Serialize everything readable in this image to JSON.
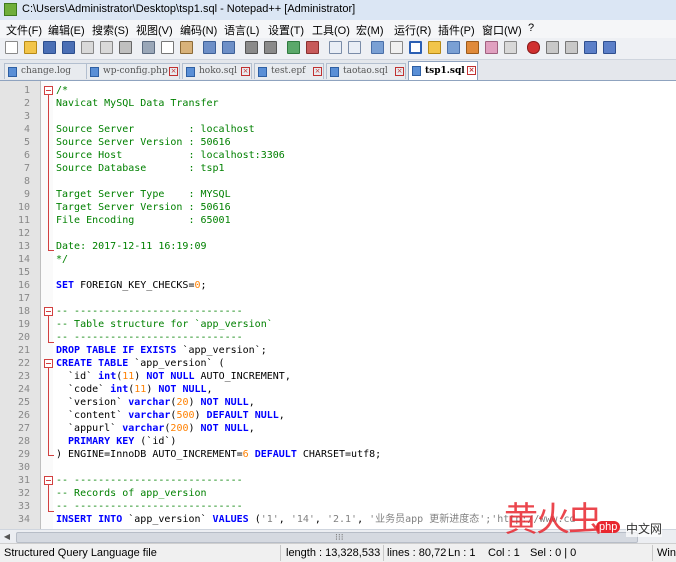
{
  "window": {
    "title": "C:\\Users\\Administrator\\Desktop\\tsp1.sql - Notepad++ [Administrator]"
  },
  "menu": [
    "文件(F)",
    "编辑(E)",
    "搜索(S)",
    "视图(V)",
    "编码(N)",
    "语言(L)",
    "设置(T)",
    "工具(O)",
    "宏(M)",
    "运行(R)",
    "插件(P)",
    "窗口(W)",
    "?"
  ],
  "tabs": [
    {
      "label": "change.log",
      "active": false
    },
    {
      "label": "wp-config.php",
      "active": false
    },
    {
      "label": "hoko.sql",
      "active": false
    },
    {
      "label": "test.epf",
      "active": false
    },
    {
      "label": "taotao.sql",
      "active": false
    },
    {
      "label": "tsp1.sql",
      "active": true
    }
  ],
  "editor": {
    "lines": [
      {
        "n": "1",
        "t": [
          [
            "com",
            "/*"
          ]
        ]
      },
      {
        "n": "2",
        "t": [
          [
            "com",
            "Navicat MySQL Data Transfer"
          ]
        ]
      },
      {
        "n": "3",
        "t": []
      },
      {
        "n": "4",
        "t": [
          [
            "com",
            "Source Server         : localhost"
          ]
        ]
      },
      {
        "n": "5",
        "t": [
          [
            "com",
            "Source Server Version : 50616"
          ]
        ]
      },
      {
        "n": "6",
        "t": [
          [
            "com",
            "Source Host           : localhost:3306"
          ]
        ]
      },
      {
        "n": "7",
        "t": [
          [
            "com",
            "Source Database       : tsp1"
          ]
        ]
      },
      {
        "n": "8",
        "t": []
      },
      {
        "n": "9",
        "t": [
          [
            "com",
            "Target Server Type    : MYSQL"
          ]
        ]
      },
      {
        "n": "10",
        "t": [
          [
            "com",
            "Target Server Version : 50616"
          ]
        ]
      },
      {
        "n": "11",
        "t": [
          [
            "com",
            "File Encoding         : 65001"
          ]
        ]
      },
      {
        "n": "12",
        "t": []
      },
      {
        "n": "13",
        "t": [
          [
            "com",
            "Date: 2017-12-11 16:19:09"
          ]
        ]
      },
      {
        "n": "14",
        "t": [
          [
            "com",
            "*/"
          ]
        ]
      },
      {
        "n": "15",
        "t": []
      },
      {
        "n": "16",
        "t": [
          [
            "kw",
            "SET"
          ],
          [
            "def",
            " FOREIGN_KEY_CHECKS="
          ],
          [
            "num",
            "0"
          ],
          [
            "def",
            ";"
          ]
        ]
      },
      {
        "n": "17",
        "t": []
      },
      {
        "n": "18",
        "t": [
          [
            "com",
            "-- ----------------------------"
          ]
        ]
      },
      {
        "n": "19",
        "t": [
          [
            "com",
            "-- Table structure for `app_version`"
          ]
        ]
      },
      {
        "n": "20",
        "t": [
          [
            "com",
            "-- ----------------------------"
          ]
        ]
      },
      {
        "n": "21",
        "t": [
          [
            "kw",
            "DROP TABLE IF EXISTS"
          ],
          [
            "def",
            " `app_version`;"
          ]
        ]
      },
      {
        "n": "22",
        "t": [
          [
            "kw",
            "CREATE TABLE"
          ],
          [
            "def",
            " `app_version` ("
          ]
        ]
      },
      {
        "n": "23",
        "t": [
          [
            "def",
            "  `id` "
          ],
          [
            "kw",
            "int"
          ],
          [
            "def",
            "("
          ],
          [
            "num",
            "11"
          ],
          [
            "def",
            ") "
          ],
          [
            "kw",
            "NOT NULL"
          ],
          [
            "def",
            " AUTO_INCREMENT,"
          ]
        ]
      },
      {
        "n": "24",
        "t": [
          [
            "def",
            "  `code` "
          ],
          [
            "kw",
            "int"
          ],
          [
            "def",
            "("
          ],
          [
            "num",
            "11"
          ],
          [
            "def",
            ") "
          ],
          [
            "kw",
            "NOT NULL"
          ],
          [
            "def",
            ","
          ]
        ]
      },
      {
        "n": "25",
        "t": [
          [
            "def",
            "  `version` "
          ],
          [
            "kw",
            "varchar"
          ],
          [
            "def",
            "("
          ],
          [
            "num",
            "20"
          ],
          [
            "def",
            ") "
          ],
          [
            "kw",
            "NOT NULL"
          ],
          [
            "def",
            ","
          ]
        ]
      },
      {
        "n": "26",
        "t": [
          [
            "def",
            "  `content` "
          ],
          [
            "kw",
            "varchar"
          ],
          [
            "def",
            "("
          ],
          [
            "num",
            "500"
          ],
          [
            "def",
            ") "
          ],
          [
            "kw",
            "DEFAULT NULL"
          ],
          [
            "def",
            ","
          ]
        ]
      },
      {
        "n": "27",
        "t": [
          [
            "def",
            "  `appurl` "
          ],
          [
            "kw",
            "varchar"
          ],
          [
            "def",
            "("
          ],
          [
            "num",
            "200"
          ],
          [
            "def",
            ") "
          ],
          [
            "kw",
            "NOT NULL"
          ],
          [
            "def",
            ","
          ]
        ]
      },
      {
        "n": "28",
        "t": [
          [
            "kw",
            "  PRIMARY KEY"
          ],
          [
            "def",
            " (`id`)"
          ]
        ]
      },
      {
        "n": "29",
        "t": [
          [
            "def",
            ") ENGINE=InnoDB AUTO_INCREMENT="
          ],
          [
            "num",
            "6"
          ],
          [
            "def",
            " "
          ],
          [
            "kw",
            "DEFAULT"
          ],
          [
            "def",
            " CHARSET=utf8;"
          ]
        ]
      },
      {
        "n": "30",
        "t": []
      },
      {
        "n": "31",
        "t": [
          [
            "com",
            "-- ----------------------------"
          ]
        ]
      },
      {
        "n": "32",
        "t": [
          [
            "com",
            "-- Records of app_version"
          ]
        ]
      },
      {
        "n": "33",
        "t": [
          [
            "com",
            "-- ----------------------------"
          ]
        ]
      },
      {
        "n": "34",
        "t": [
          [
            "kw",
            "INSERT INTO"
          ],
          [
            "def",
            " `app_version` "
          ],
          [
            "kw",
            "VALUES"
          ],
          [
            "def",
            " ("
          ],
          [
            "str",
            "'1'"
          ],
          [
            "def",
            ", "
          ],
          [
            "str",
            "'14'"
          ],
          [
            "def",
            ", "
          ],
          [
            "str",
            "'2.1'"
          ],
          [
            "def",
            ", "
          ],
          [
            "str",
            "'业务员app 更新进度态';'http://www.cd"
          ]
        ]
      }
    ]
  },
  "status": {
    "filetype": "Structured Query Language file",
    "length": "length : 13,328,533",
    "lines": "lines : 80,72",
    "ln": "Ln : 1",
    "col": "Col : 1",
    "sel": "Sel : 0 | 0",
    "eol": "Win"
  },
  "watermark": {
    "big": "黄火虫",
    "php": "php",
    "cn": "中文网"
  },
  "colors": {
    "comment": "#008000",
    "keyword": "#0000ff",
    "number": "#ff8000",
    "string": "#808080",
    "fold_marker": "#d24040"
  }
}
